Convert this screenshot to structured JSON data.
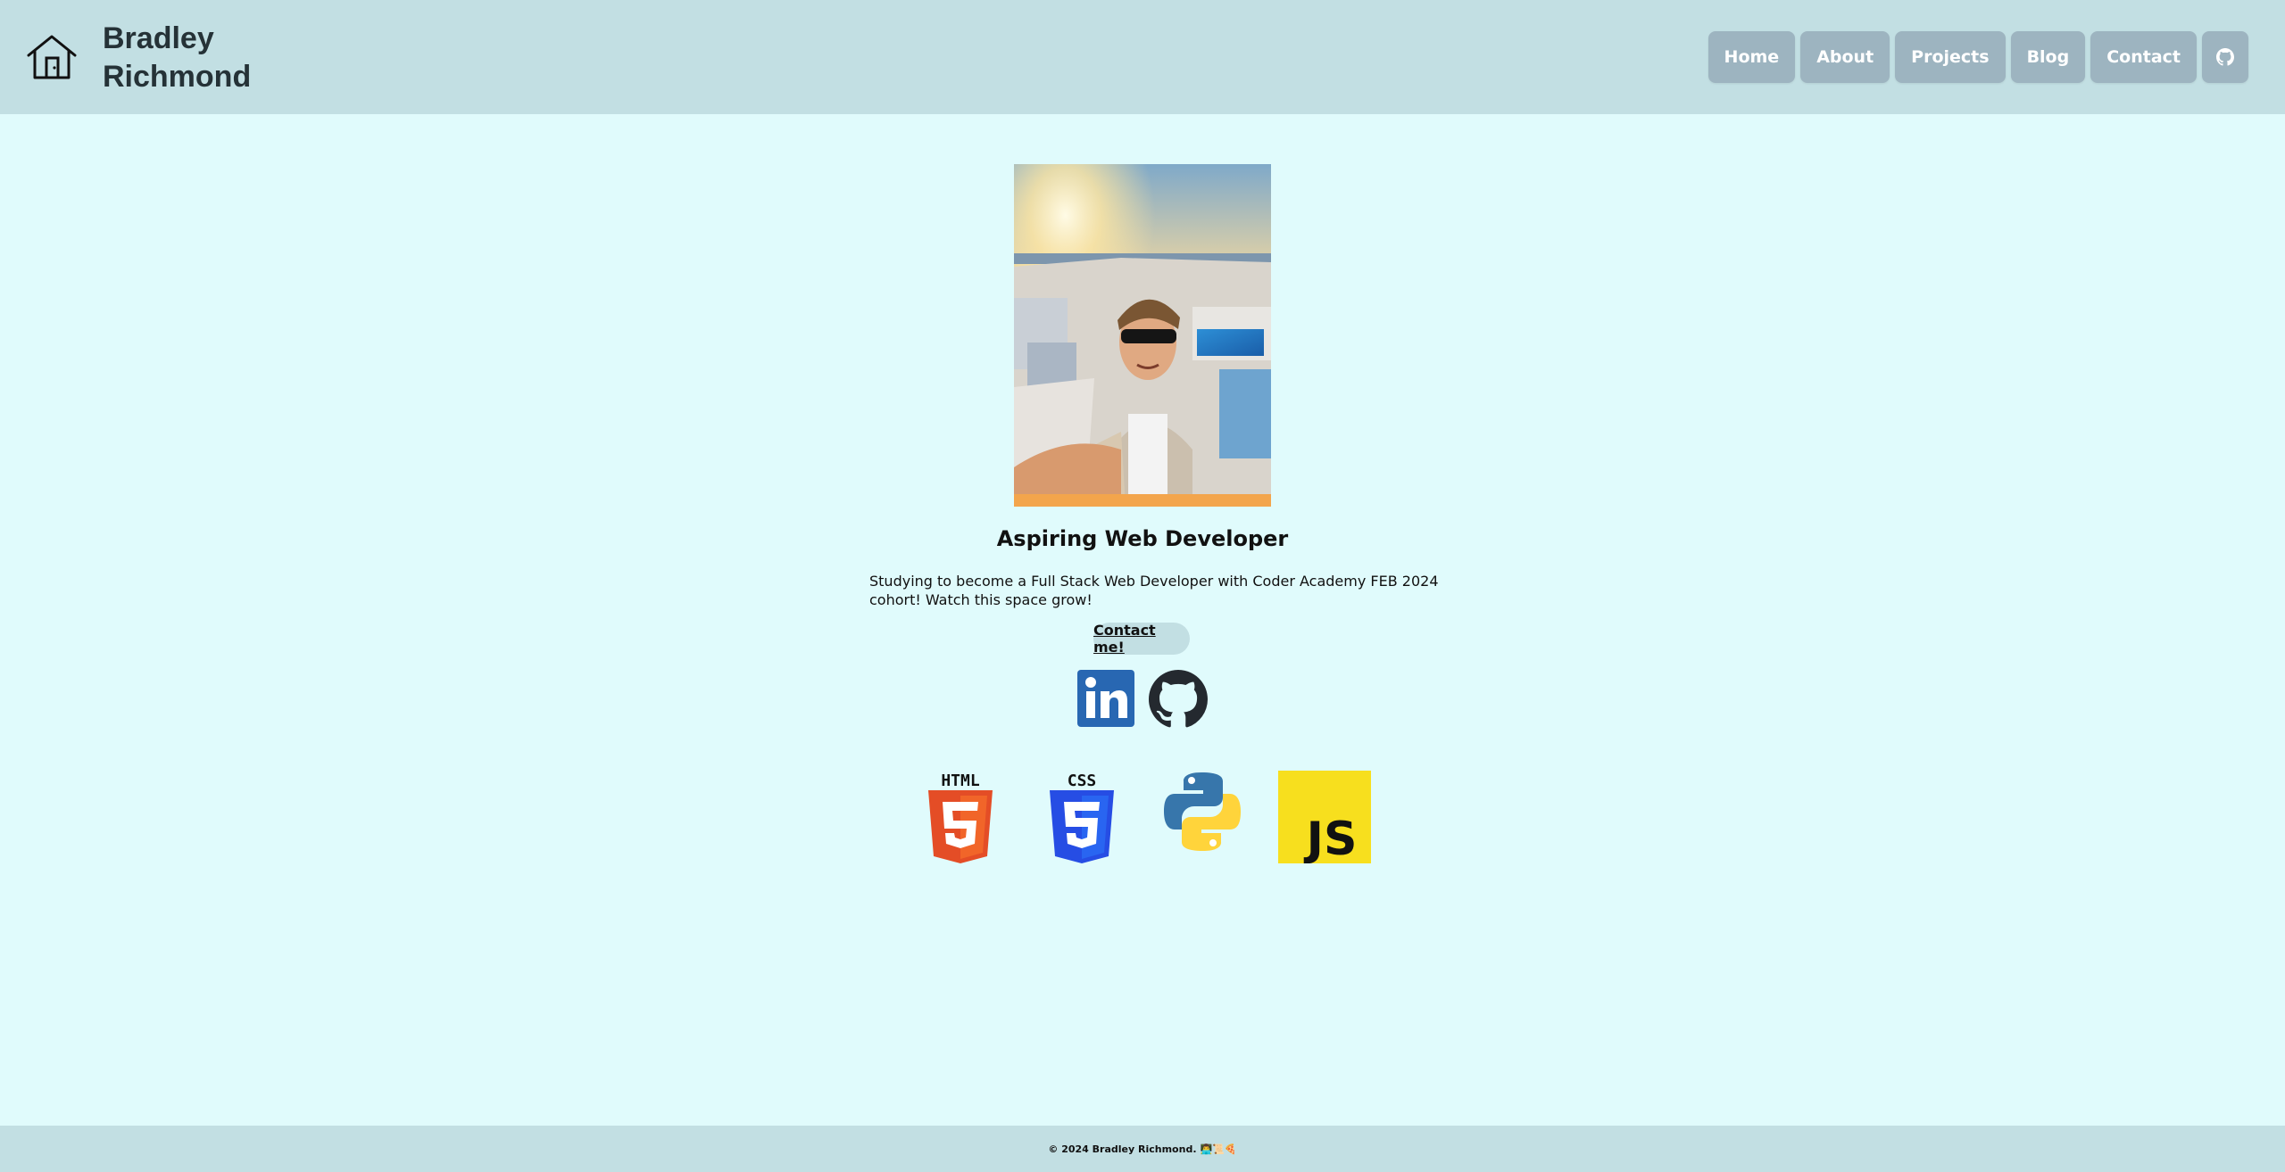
{
  "header": {
    "site_name": "Bradley Richmond",
    "home_icon": "home-icon",
    "nav": [
      {
        "label": "Home"
      },
      {
        "label": "About"
      },
      {
        "label": "Projects"
      },
      {
        "label": "Blog"
      },
      {
        "label": "Contact"
      }
    ],
    "github_icon": "github-icon"
  },
  "hero": {
    "photo": "profile-photo",
    "headline": "Aspiring Web Developer",
    "intro": "Studying to become a Full Stack Web Developer with Coder Academy FEB 2024 cohort! Watch this space grow!",
    "contact_button": "Contact me!"
  },
  "social": [
    "linkedin-icon",
    "github-icon"
  ],
  "tech": [
    {
      "name": "html5-logo",
      "label": "HTML"
    },
    {
      "name": "css3-logo",
      "label": "CSS"
    },
    {
      "name": "python-logo"
    },
    {
      "name": "javascript-logo",
      "label": "JS"
    }
  ],
  "footer": {
    "text": "© 2024 Bradley Richmond.",
    "emojis": "👨‍💻📜🍕"
  },
  "colors": {
    "background": "#e0fbfc",
    "header": "#c2dfe3",
    "nav_button": "#9db4c0",
    "text_dark": "#253237"
  }
}
